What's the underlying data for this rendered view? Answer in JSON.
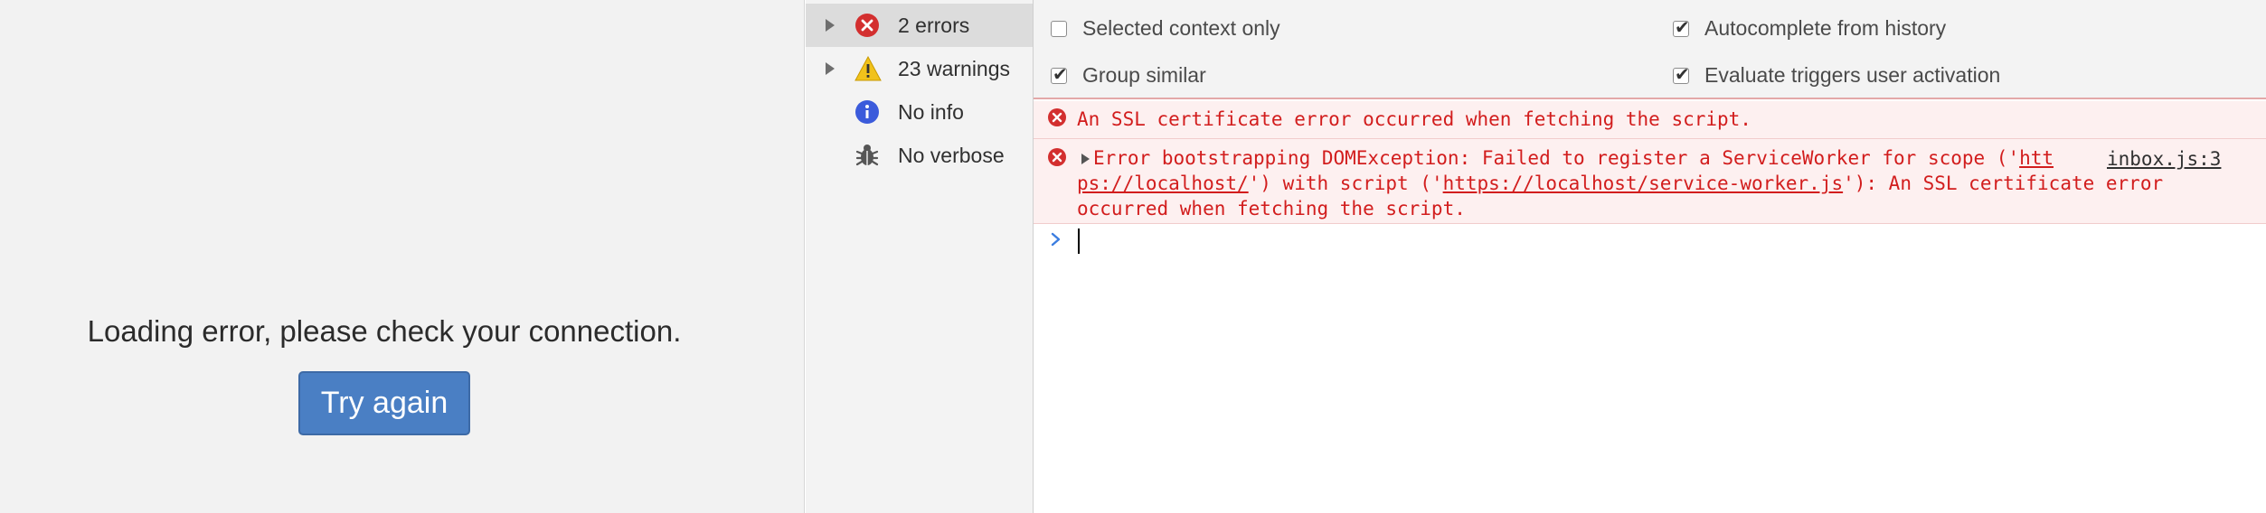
{
  "page": {
    "error_message": "Loading error, please check your connection.",
    "retry_label": "Try again"
  },
  "sidebar": {
    "items": [
      {
        "label": "2 errors",
        "icon": "error-icon",
        "expandable": true,
        "selected": true
      },
      {
        "label": "23 warnings",
        "icon": "warning-icon",
        "expandable": true,
        "selected": false
      },
      {
        "label": "No info",
        "icon": "info-icon",
        "expandable": false,
        "selected": false
      },
      {
        "label": "No verbose",
        "icon": "bug-icon",
        "expandable": false,
        "selected": false
      }
    ]
  },
  "settings": {
    "selected_context_only": {
      "label": "Selected context only",
      "checked": false
    },
    "group_similar": {
      "label": "Group similar",
      "checked": true
    },
    "autocomplete_history": {
      "label": "Autocomplete from history",
      "checked": true
    },
    "evaluate_triggers": {
      "label": "Evaluate triggers user activation",
      "checked": true
    }
  },
  "messages": {
    "ssl_error": "An SSL certificate error occurred when fetching the script.",
    "bootstrap": {
      "line1_prefix": "Error bootstrapping DOMException: Failed to register a ServiceWorker for scope ('",
      "line1_link": "htt",
      "line2_link": "ps://localhost/",
      "line2_middle": "') with script ('",
      "line2_link2": "https://localhost/service-worker.js",
      "line2_suffix": "'): An SSL certificate error",
      "line3": "occurred when fetching the script.",
      "source": "inbox.js:3"
    }
  },
  "colors": {
    "error": "#d21d1d",
    "warning": "#f1c21b",
    "info": "#3b5bdb",
    "button": "#4a7fc4"
  }
}
